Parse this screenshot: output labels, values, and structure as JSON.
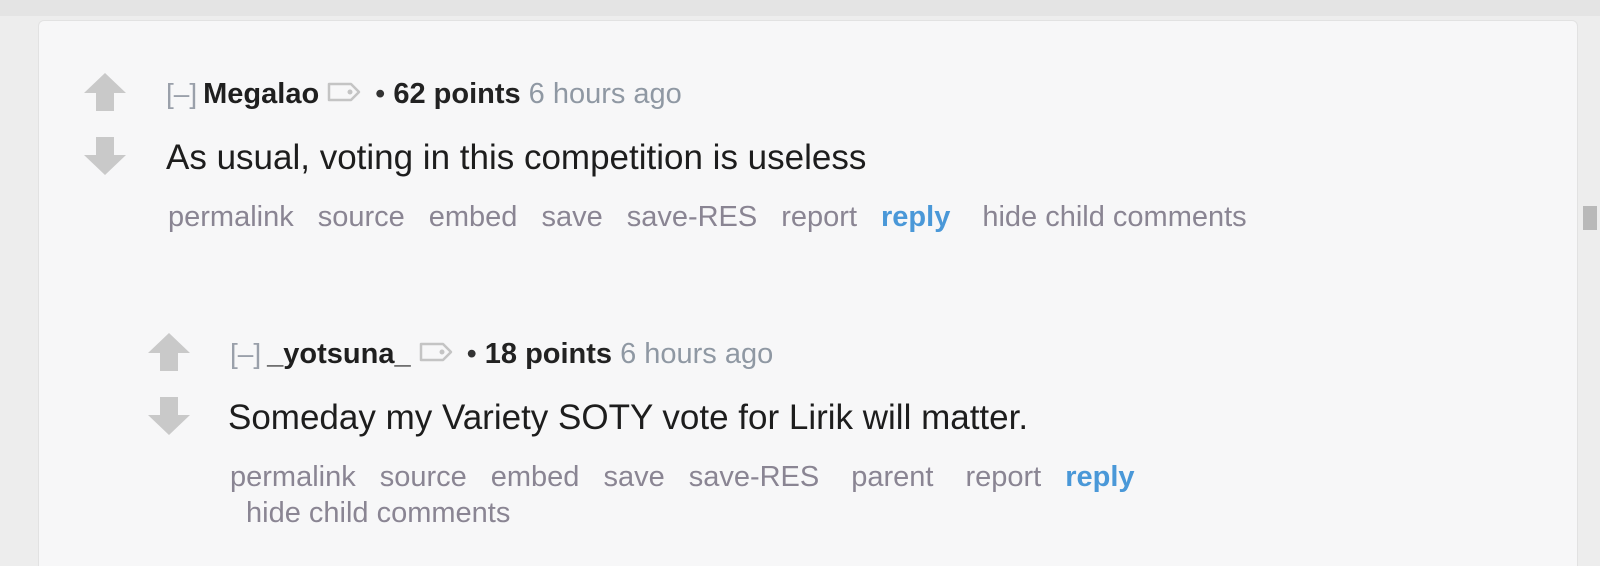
{
  "comments": [
    {
      "collapse": "[–]",
      "author": "Megalao",
      "bullet": "•",
      "score": "62 points",
      "time": "6 hours ago",
      "body": "As usual, voting in this competition is useless",
      "buttons": {
        "permalink": "permalink",
        "source": "source",
        "embed": "embed",
        "save": "save",
        "save_res": "save-RES",
        "report": "report",
        "reply": "reply",
        "hide_child": "hide child comments"
      }
    },
    {
      "collapse": "[–]",
      "author": "_yotsuna_",
      "bullet": "•",
      "score": "18 points",
      "time": "6 hours ago",
      "body": "Someday my Variety SOTY vote for Lirik will matter.",
      "buttons": {
        "permalink": "permalink",
        "source": "source",
        "embed": "embed",
        "save": "save",
        "save_res": "save-RES",
        "parent": "parent",
        "report": "report",
        "reply": "reply",
        "hide_child": "hide child comments"
      }
    }
  ],
  "colors": {
    "reply": "#4a98d8",
    "muted": "#8a8593",
    "time": "#8f98a3",
    "arrow": "#c9c9c9"
  }
}
